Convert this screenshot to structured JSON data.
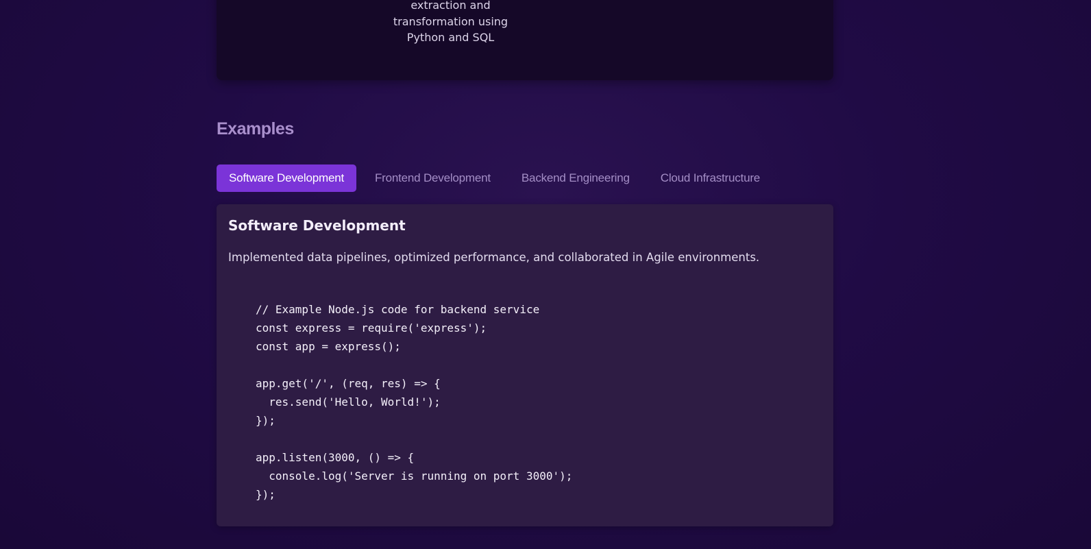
{
  "top_card": {
    "lines": [
      "extraction and",
      "transformation using",
      "Python and SQL"
    ]
  },
  "examples": {
    "title": "Examples",
    "tabs": [
      {
        "label": "Software Development",
        "active": true
      },
      {
        "label": "Frontend Development",
        "active": false
      },
      {
        "label": "Backend Engineering",
        "active": false
      },
      {
        "label": "Cloud Infrastructure",
        "active": false
      }
    ],
    "panel": {
      "title": "Software Development",
      "description": "Implemented data pipelines, optimized performance, and collaborated in Agile environments.",
      "code": "// Example Node.js code for backend service\nconst express = require('express');\nconst app = express();\n\napp.get('/', (req, res) => {\n  res.send('Hello, World!');\n});\n\napp.listen(3000, () => {\n  console.log('Server is running on port 3000');\n});"
    }
  },
  "colors": {
    "background": "#200b45",
    "accent": "#7b34d8",
    "heading": "#a98fcc",
    "panel": "#2e1c44",
    "card": "#150828"
  }
}
